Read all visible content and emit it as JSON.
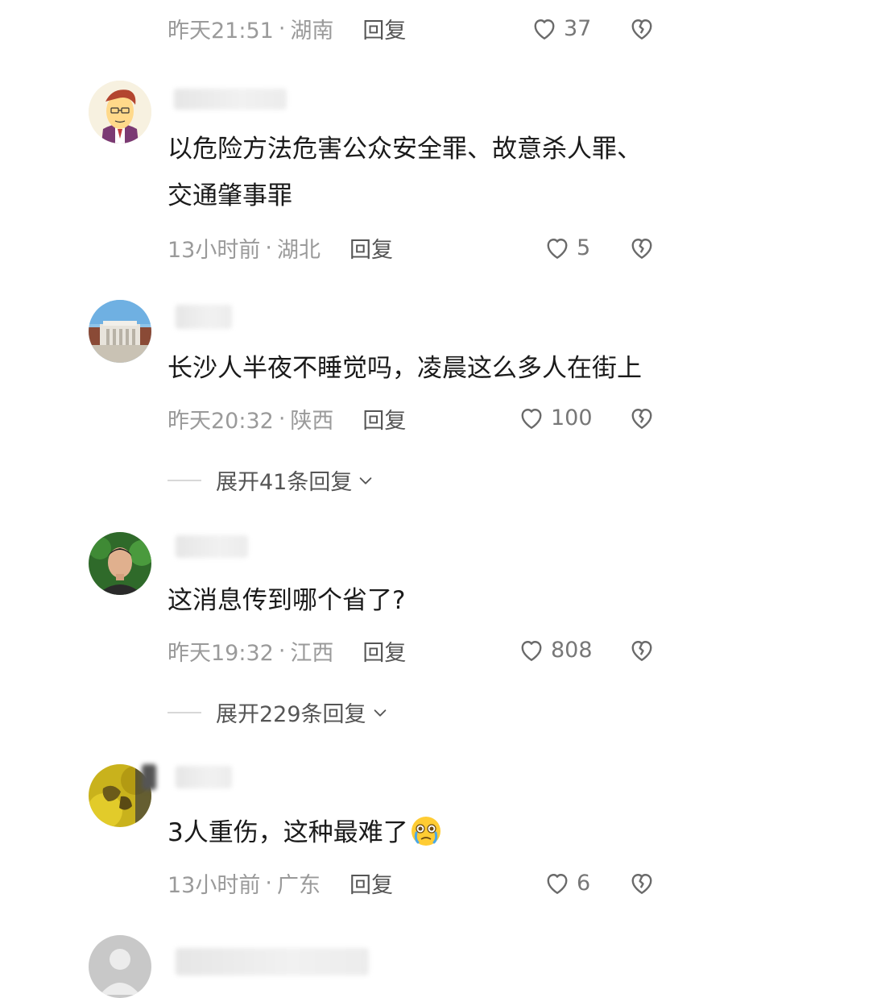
{
  "comments": [
    {
      "meta_time": "昨天21:51",
      "meta_region": "湖南",
      "reply_label": "回复",
      "likes": "37"
    },
    {
      "text_line1": "以危险方法危害公众安全罪、故意杀人罪、",
      "text_line2": "交通肇事罪",
      "meta_time": "13小时前",
      "meta_region": "湖北",
      "reply_label": "回复",
      "likes": "5"
    },
    {
      "text_line1": "长沙人半夜不睡觉吗，凌晨这么多人在街上",
      "meta_time": "昨天20:32",
      "meta_region": "陕西",
      "reply_label": "回复",
      "likes": "100",
      "expand_label": "展开41条回复"
    },
    {
      "text_line1": "这消息传到哪个省了?",
      "meta_time": "昨天19:32",
      "meta_region": "江西",
      "reply_label": "回复",
      "likes": "808",
      "expand_label": "展开229条回复"
    },
    {
      "text_line1": "3人重伤，这种最难了",
      "emoji": "crying-face-emoji",
      "meta_time": "13小时前",
      "meta_region": "广东",
      "reply_label": "回复",
      "likes": "6"
    }
  ],
  "meta_separator": "·",
  "colors": {
    "text_primary": "#1a1a1a",
    "text_meta": "#9a9a9a",
    "text_link": "#555555",
    "background": "#ffffff"
  },
  "icons": {
    "like": "heart-outline-icon",
    "dislike": "broken-heart-icon",
    "expand": "chevron-down-icon"
  }
}
